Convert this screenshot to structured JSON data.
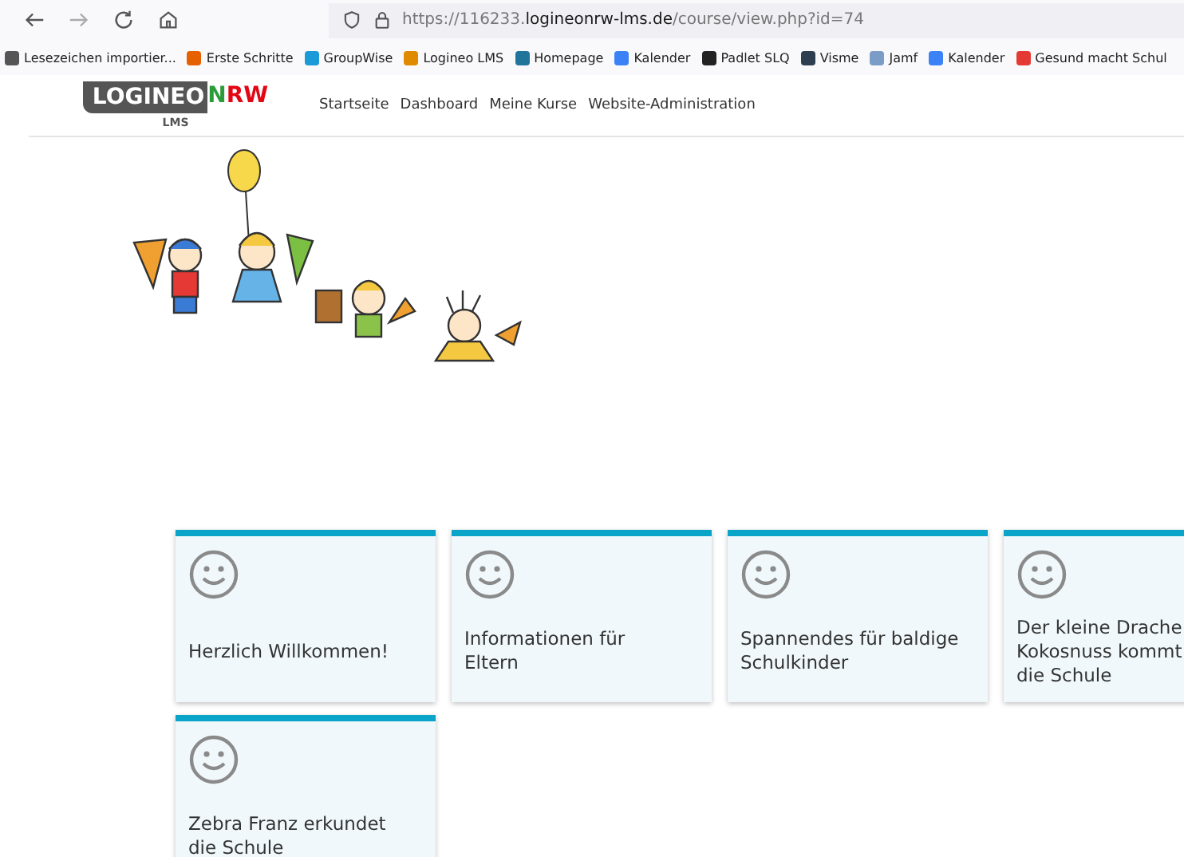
{
  "browser": {
    "url": "https://116233.**logineonrw-lms.de**/course/view.php?id=74",
    "bookmarks": [
      {
        "label": "Lesezeichen importier...",
        "color": "#555555"
      },
      {
        "label": "Erste Schritte",
        "color": "#e66000"
      },
      {
        "label": "GroupWise",
        "color": "#1a9ad6"
      },
      {
        "label": "Logineo LMS",
        "color": "#e08a00"
      },
      {
        "label": "Homepage",
        "color": "#21759b"
      },
      {
        "label": "Kalender",
        "color": "#3b82f6"
      },
      {
        "label": "Padlet SLQ",
        "color": "#222222"
      },
      {
        "label": "Visme",
        "color": "#2c3e50"
      },
      {
        "label": "Jamf",
        "color": "#7a9cc6"
      },
      {
        "label": "Kalender",
        "color": "#3b82f6"
      },
      {
        "label": "Gesund macht Schul",
        "color": "#e53935"
      }
    ]
  },
  "site": {
    "logo": {
      "part1": "LOGINEO",
      "part2": "NRW",
      "sub": "LMS"
    },
    "nav": [
      "Startseite",
      "Dashboard",
      "Meine Kurse",
      "Website-Administration"
    ]
  },
  "cards": [
    {
      "lines": [
        "Herzlich Willkommen!"
      ]
    },
    {
      "lines": [
        "Informationen für",
        "Eltern"
      ]
    },
    {
      "lines": [
        "Spannendes für baldige",
        "Schulkinder"
      ]
    },
    {
      "lines": [
        "Der kleine Drache",
        "Kokosnuss kommt",
        "die Schule"
      ]
    },
    {
      "lines": [
        "Zebra Franz erkundet",
        "die Schule"
      ]
    }
  ]
}
